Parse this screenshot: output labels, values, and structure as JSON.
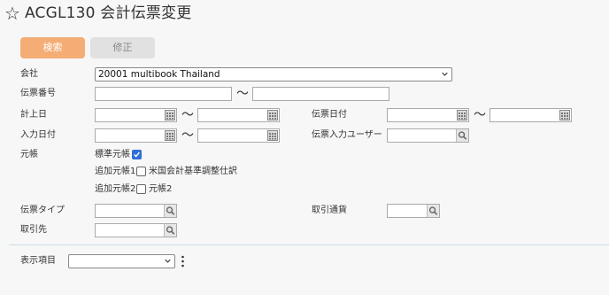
{
  "header": {
    "title": "ACGL130 会計伝票変更",
    "star_icon": "star-outline-icon"
  },
  "toolbar": {
    "search_label": "検索",
    "edit_label": "修正",
    "search_color": "#f4ad75",
    "edit_color": "#e1e1e1"
  },
  "form": {
    "company_label": "会社",
    "company_value": "20001 multibook Thailand",
    "voucher_no_label": "伝票番号",
    "posting_date_label": "計上日",
    "voucher_date_label": "伝票日付",
    "input_date_label": "入力日付",
    "voucher_input_user_label": "伝票入力ユーザー",
    "ledger_label": "元帳",
    "standard_ledger_label": "標準元帳",
    "standard_ledger_checked": true,
    "additional_ledger1_label": "追加元帳1",
    "additional_ledger1_option": "米国会計基準調整仕訳",
    "additional_ledger1_checked": false,
    "additional_ledger2_label": "追加元帳2",
    "additional_ledger2_option": "元帳2",
    "additional_ledger2_checked": false,
    "voucher_type_label": "伝票タイプ",
    "transaction_currency_label": "取引通貨",
    "counterparty_label": "取引先",
    "range_separator": "～"
  },
  "footer": {
    "display_items_label": "表示項目",
    "display_items_value": ""
  },
  "colors": {
    "accent": "#f4ad75",
    "checkbox": "#2f6fd6",
    "divider": "#c9dceb"
  }
}
